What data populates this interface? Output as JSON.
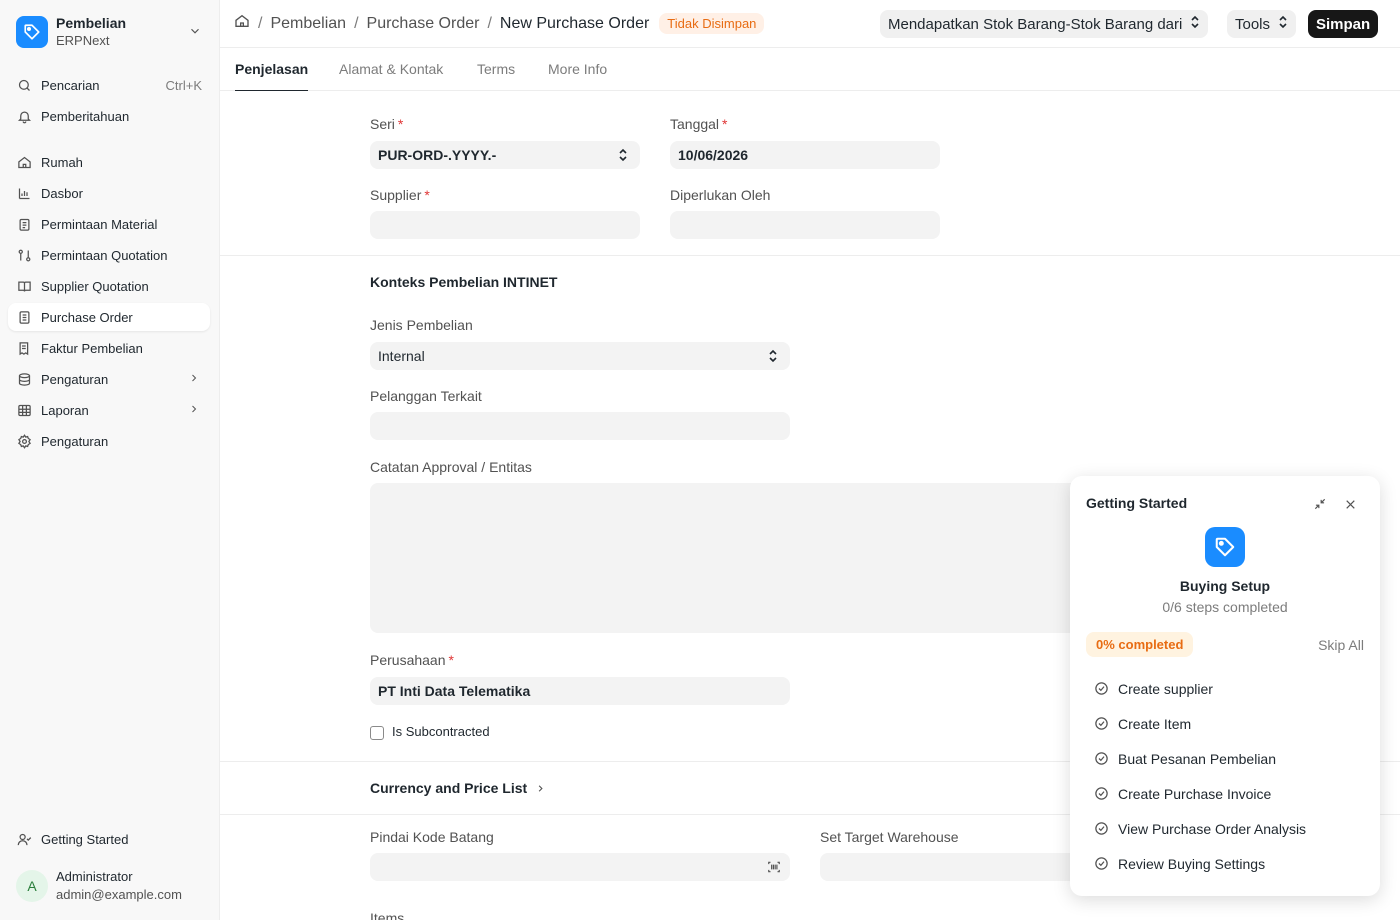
{
  "app": {
    "name": "Pembelian",
    "subtitle": "ERPNext"
  },
  "sidebar": {
    "search": {
      "label": "Pencarian",
      "shortcut": "Ctrl+K"
    },
    "notifications": {
      "label": "Pemberitahuan"
    },
    "items": [
      {
        "label": "Rumah",
        "icon": "home-icon"
      },
      {
        "label": "Dasbor",
        "icon": "bar-chart-icon"
      },
      {
        "label": "Permintaan Material",
        "icon": "clipboard-icon"
      },
      {
        "label": "Permintaan Quotation",
        "icon": "git-compare-icon"
      },
      {
        "label": "Supplier Quotation",
        "icon": "book-icon"
      },
      {
        "label": "Purchase Order",
        "icon": "file-text-icon",
        "active": true
      },
      {
        "label": "Faktur Pembelian",
        "icon": "receipt-icon"
      },
      {
        "label": "Pengaturan",
        "icon": "database-icon",
        "expandable": true
      },
      {
        "label": "Laporan",
        "icon": "table-icon",
        "expandable": true
      },
      {
        "label": "Pengaturan",
        "icon": "gear-icon"
      }
    ],
    "getting_started": {
      "label": "Getting Started"
    },
    "user": {
      "initial": "A",
      "name": "Administrator",
      "email": "admin@example.com"
    }
  },
  "header": {
    "breadcrumbs": [
      "Pembelian",
      "Purchase Order"
    ],
    "title": "New Purchase Order",
    "status": "Tidak Disimpan",
    "get_items_label": "Mendapatkan Stok Barang-Stok Barang dari",
    "tools_label": "Tools",
    "save_label": "Simpan"
  },
  "tabs": [
    "Penjelasan",
    "Alamat & Kontak",
    "Terms",
    "More Info"
  ],
  "form": {
    "series": {
      "label": "Seri",
      "value": "PUR-ORD-.YYYY.-"
    },
    "date": {
      "label": "Tanggal",
      "value": "10/06/2026"
    },
    "supplier": {
      "label": "Supplier",
      "value": ""
    },
    "required_by": {
      "label": "Diperlukan Oleh",
      "value": ""
    },
    "section_context": "Konteks Pembelian INTINET",
    "purchase_type": {
      "label": "Jenis Pembelian",
      "value": "Internal"
    },
    "related_customer": {
      "label": "Pelanggan Terkait",
      "value": ""
    },
    "approval_notes": {
      "label": "Catatan Approval / Entitas",
      "value": ""
    },
    "company": {
      "label": "Perusahaan",
      "value": "PT Inti Data Telematika"
    },
    "is_subcontracted": {
      "label": "Is Subcontracted",
      "checked": false
    },
    "section_currency": "Currency and Price List",
    "scan_barcode": {
      "label": "Pindai Kode Batang",
      "value": ""
    },
    "target_warehouse": {
      "label": "Set Target Warehouse",
      "value": ""
    },
    "items_label": "Items"
  },
  "getting_started_panel": {
    "title": "Getting Started",
    "setup_name": "Buying Setup",
    "steps_text": "0/6 steps completed",
    "progress_text": "0% completed",
    "progress": 0,
    "skip_label": "Skip All",
    "steps": [
      "Create supplier",
      "Create Item",
      "Buat Pesanan Pembelian",
      "Create Purchase Invoice",
      "View Purchase Order Analysis",
      "Review Buying Settings"
    ]
  },
  "colors": {
    "accent": "#1a8cff",
    "primary_button": "#171717",
    "warning": "#e86c13",
    "required": "#e03636"
  }
}
